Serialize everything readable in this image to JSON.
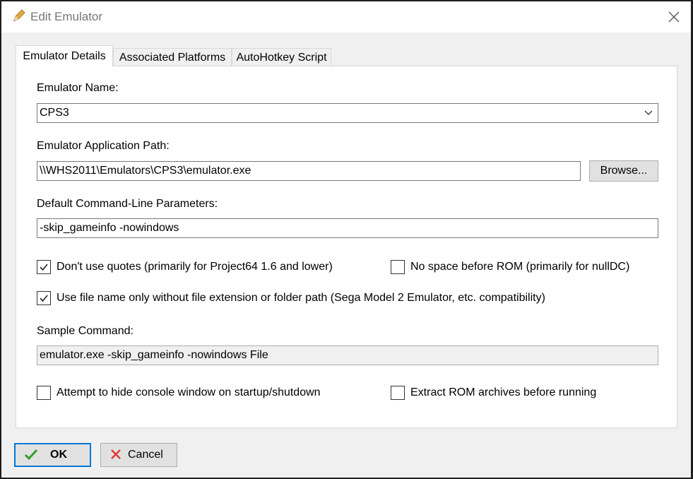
{
  "window": {
    "title": "Edit Emulator"
  },
  "tabs": [
    {
      "label": "Emulator Details"
    },
    {
      "label": "Associated Platforms"
    },
    {
      "label": "AutoHotkey Script"
    }
  ],
  "form": {
    "name_label": "Emulator Name:",
    "name_value": "CPS3",
    "path_label": "Emulator Application Path:",
    "path_value": "\\\\WHS2011\\Emulators\\CPS3\\emulator.exe",
    "browse_label": "Browse...",
    "params_label": "Default Command-Line Parameters:",
    "params_value": "-skip_gameinfo -nowindows",
    "sample_label": "Sample Command:",
    "sample_value": "emulator.exe -skip_gameinfo -nowindows File"
  },
  "checkboxes": {
    "no_quotes": {
      "label": "Don't use quotes (primarily for Project64 1.6 and lower)",
      "checked": true
    },
    "no_space": {
      "label": "No space before ROM (primarily for nullDC)",
      "checked": false
    },
    "filename_only": {
      "label": "Use file name only without file extension or folder path (Sega Model 2 Emulator, etc. compatibility)",
      "checked": true
    },
    "hide_console": {
      "label": "Attempt to hide console window on startup/shutdown",
      "checked": false
    },
    "extract_rom": {
      "label": "Extract ROM archives before running",
      "checked": false
    }
  },
  "buttons": {
    "ok": "OK",
    "cancel": "Cancel"
  },
  "colors": {
    "accent": "#0078d7",
    "ok_check": "#2e9e2e",
    "cancel_x": "#e03a3a"
  }
}
